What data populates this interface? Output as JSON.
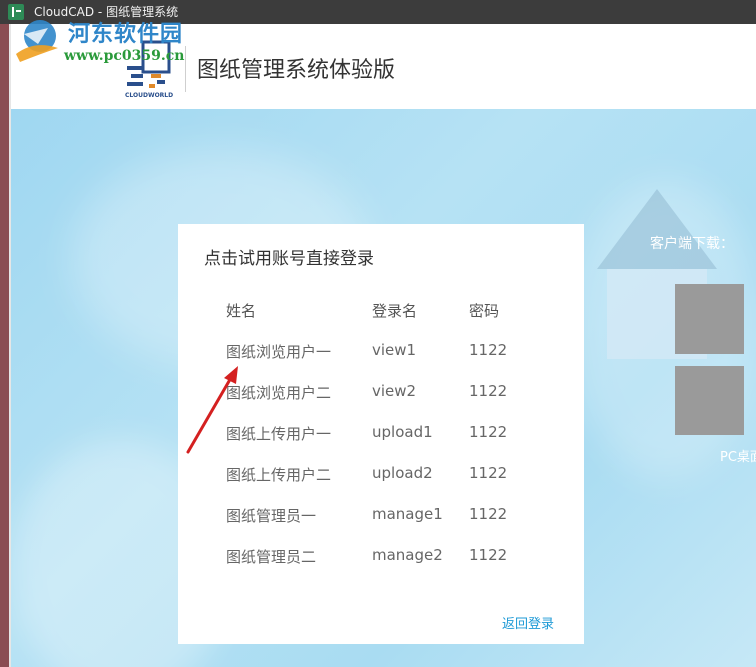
{
  "window": {
    "title": "CloudCAD - 图纸管理系统"
  },
  "watermark": {
    "title": "河东软件园",
    "url": "www.pc0359.cn"
  },
  "header": {
    "logo_caption": "CLOUDWORLD",
    "system_title": "图纸管理系统体验版"
  },
  "card": {
    "title": "点击试用账号直接登录",
    "columns": [
      "姓名",
      "登录名",
      "密码"
    ],
    "rows": [
      {
        "name": "图纸浏览用户一",
        "login": "view1",
        "password": "1122"
      },
      {
        "name": "图纸浏览用户二",
        "login": "view2",
        "password": "1122"
      },
      {
        "name": "图纸上传用户一",
        "login": "upload1",
        "password": "1122"
      },
      {
        "name": "图纸上传用户二",
        "login": "upload2",
        "password": "1122"
      },
      {
        "name": "图纸管理员一",
        "login": "manage1",
        "password": "1122"
      },
      {
        "name": "图纸管理员二",
        "login": "manage2",
        "password": "1122"
      }
    ],
    "back_link": "返回登录"
  },
  "sidebar": {
    "download_label": "客户端下载：",
    "pc_label": "PC桌面"
  },
  "colors": {
    "accent": "#1e9ad6",
    "hero": "#a9dcf2",
    "arrow": "#d42020"
  }
}
